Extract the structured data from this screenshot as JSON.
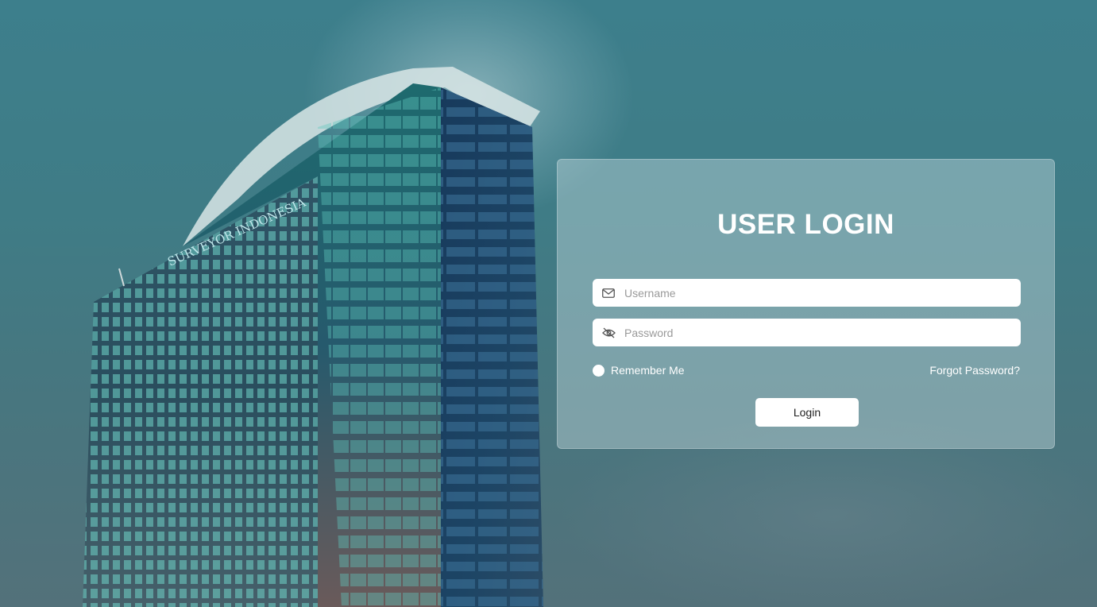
{
  "background": {
    "building_sign": "SURVEYOR INDONESIA"
  },
  "login": {
    "title": "USER LOGIN",
    "username": {
      "placeholder": "Username",
      "value": "",
      "icon": "envelope-icon"
    },
    "password": {
      "placeholder": "Password",
      "value": "",
      "icon": "eye-off-icon"
    },
    "remember_label": "Remember Me",
    "forgot_label": "Forgot Password?",
    "submit_label": "Login"
  },
  "colors": {
    "sky": "#3f7c86",
    "card": "#c8dee2",
    "text": "#ffffff"
  }
}
